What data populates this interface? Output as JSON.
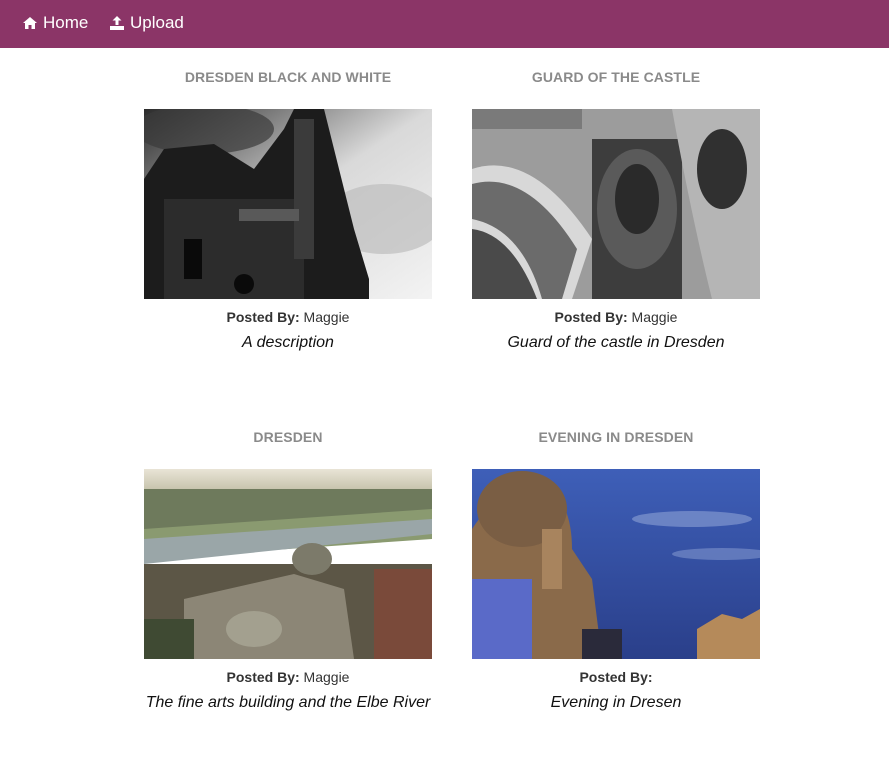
{
  "nav": {
    "home_icon": "home-icon",
    "home_label": "Home",
    "upload_icon": "upload-icon",
    "upload_label": "Upload",
    "background_color": "#8b3567"
  },
  "photos": [
    {
      "title": "DRESDEN BLACK AND WHITE",
      "posted_by_label": "Posted By:",
      "posted_by": "Maggie",
      "description": "A description"
    },
    {
      "title": "GUARD OF THE CASTLE",
      "posted_by_label": "Posted By:",
      "posted_by": "Maggie",
      "description": "Guard of the castle in Dresden"
    },
    {
      "title": "DRESDEN",
      "posted_by_label": "Posted By:",
      "posted_by": "Maggie",
      "description": "The fine arts building and the Elbe River"
    },
    {
      "title": "EVENING IN DRESDEN",
      "posted_by_label": "Posted By:",
      "posted_by": "",
      "description": "Evening in Dresen"
    }
  ]
}
